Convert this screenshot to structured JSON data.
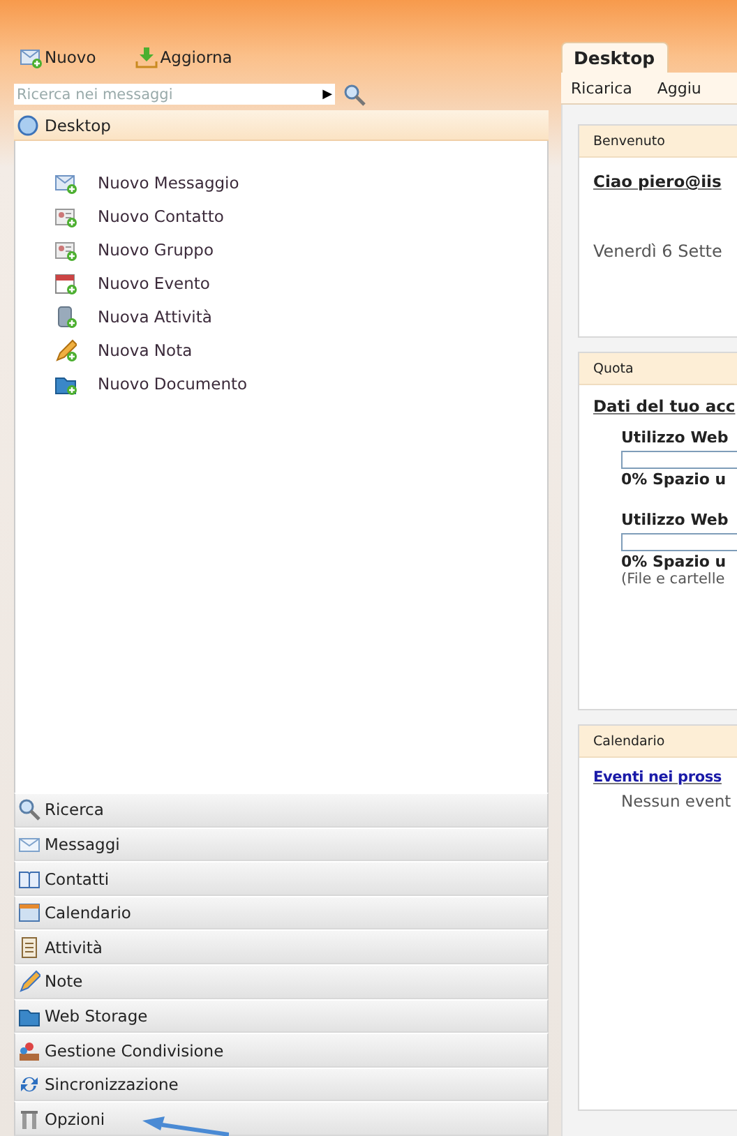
{
  "toolbar": {
    "buttons": [
      "Nuovo",
      "Aggiorna"
    ]
  },
  "search": {
    "placeholder": "Ricerca nei messaggi",
    "arrow": "▶"
  },
  "desktop_header": {
    "title": "Desktop"
  },
  "quick_actions": [
    {
      "label": "Nuovo Messaggio"
    },
    {
      "label": "Nuovo Contatto"
    },
    {
      "label": "Nuovo Gruppo"
    },
    {
      "label": "Nuovo Evento"
    },
    {
      "label": "Nuova Attività"
    },
    {
      "label": "Nuova Nota"
    },
    {
      "label": "Nuovo Documento"
    }
  ],
  "nav": [
    {
      "label": "Ricerca"
    },
    {
      "label": "Messaggi"
    },
    {
      "label": "Contatti"
    },
    {
      "label": "Calendario"
    },
    {
      "label": "Attività"
    },
    {
      "label": "Note"
    },
    {
      "label": "Web Storage"
    },
    {
      "label": "Gestione Condivisione"
    },
    {
      "label": "Sincronizzazione"
    },
    {
      "label": "Opzioni"
    }
  ],
  "tabs": [
    {
      "label": "Desktop",
      "selected": true
    }
  ],
  "tab_toolbar": [
    "Ricarica",
    "Aggiu"
  ],
  "portlets": [
    {
      "title": "Benvenuto",
      "kind": "welcome",
      "greeting": "Ciao piero@iis",
      "date": "Venerdì 6 Sette"
    },
    {
      "title": "Quota",
      "kind": "quota",
      "heading": "Dati del tuo acc",
      "meters": [
        {
          "label": "Utilizzo Web",
          "level": 0,
          "reading": "0% Spazio u"
        },
        {
          "label": "Utilizzo Web",
          "level": 0,
          "reading": "0% Spazio u",
          "note": "(File e cartelle"
        }
      ]
    },
    {
      "title": "Calendario",
      "kind": "calendar",
      "heading": "Eventi nei pross",
      "empty": "Nessun event"
    }
  ]
}
